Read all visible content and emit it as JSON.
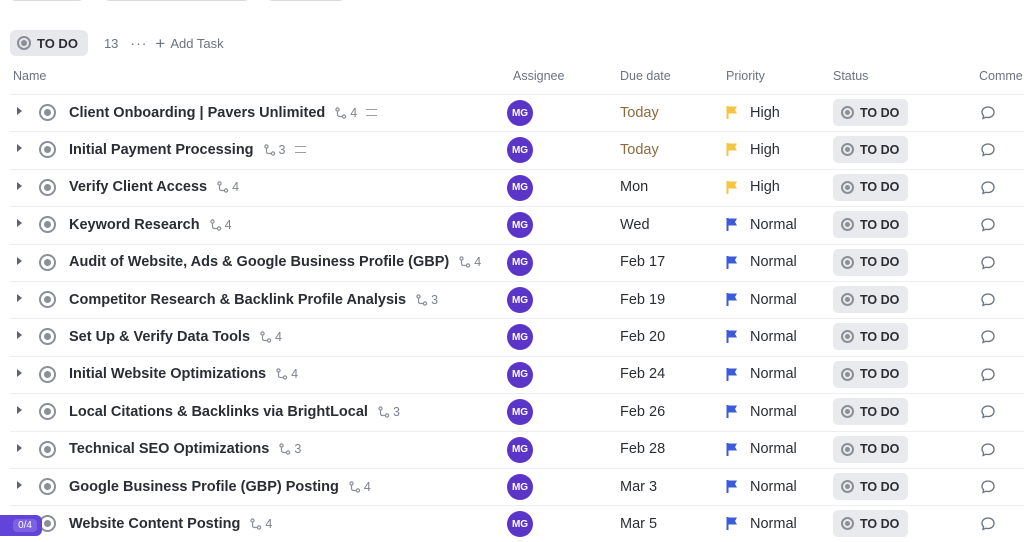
{
  "group": {
    "status_label": "TO DO",
    "count": "13",
    "more_label": "···",
    "add_task_label": "Add Task"
  },
  "columns": {
    "name": "Name",
    "assignee": "Assignee",
    "due_date": "Due date",
    "priority": "Priority",
    "status": "Status",
    "comments": "Comme"
  },
  "tasks": [
    {
      "name": "Client Onboarding | Pavers Unlimited",
      "subtasks": "4",
      "has_description": true,
      "assignee": "MG",
      "due": "Today",
      "due_style": "today",
      "priority": "High",
      "status": "TO DO"
    },
    {
      "name": "Initial Payment Processing",
      "subtasks": "3",
      "has_description": true,
      "assignee": "MG",
      "due": "Today",
      "due_style": "today",
      "priority": "High",
      "status": "TO DO"
    },
    {
      "name": "Verify Client Access",
      "subtasks": "4",
      "has_description": false,
      "assignee": "MG",
      "due": "Mon",
      "due_style": "normal",
      "priority": "High",
      "status": "TO DO"
    },
    {
      "name": "Keyword Research",
      "subtasks": "4",
      "has_description": false,
      "assignee": "MG",
      "due": "Wed",
      "due_style": "normal",
      "priority": "Normal",
      "status": "TO DO"
    },
    {
      "name": "Audit of Website, Ads & Google Business Profile (GBP)",
      "subtasks": "4",
      "has_description": false,
      "assignee": "MG",
      "due": "Feb 17",
      "due_style": "normal",
      "priority": "Normal",
      "status": "TO DO"
    },
    {
      "name": "Competitor Research & Backlink Profile Analysis",
      "subtasks": "3",
      "has_description": false,
      "assignee": "MG",
      "due": "Feb 19",
      "due_style": "normal",
      "priority": "Normal",
      "status": "TO DO"
    },
    {
      "name": "Set Up & Verify Data Tools",
      "subtasks": "4",
      "has_description": false,
      "assignee": "MG",
      "due": "Feb 20",
      "due_style": "normal",
      "priority": "Normal",
      "status": "TO DO"
    },
    {
      "name": "Initial Website Optimizations",
      "subtasks": "4",
      "has_description": false,
      "assignee": "MG",
      "due": "Feb 24",
      "due_style": "normal",
      "priority": "Normal",
      "status": "TO DO"
    },
    {
      "name": "Local Citations & Backlinks via BrightLocal",
      "subtasks": "3",
      "has_description": false,
      "assignee": "MG",
      "due": "Feb 26",
      "due_style": "normal",
      "priority": "Normal",
      "status": "TO DO"
    },
    {
      "name": "Technical SEO Optimizations",
      "subtasks": "3",
      "has_description": false,
      "assignee": "MG",
      "due": "Feb 28",
      "due_style": "normal",
      "priority": "Normal",
      "status": "TO DO"
    },
    {
      "name": "Google Business Profile (GBP) Posting",
      "subtasks": "4",
      "has_description": false,
      "assignee": "MG",
      "due": "Mar 3",
      "due_style": "normal",
      "priority": "Normal",
      "status": "TO DO"
    },
    {
      "name": "Website Content Posting",
      "subtasks": "4",
      "has_description": false,
      "assignee": "MG",
      "due": "Mar 5",
      "due_style": "normal",
      "priority": "Normal",
      "status": "TO DO"
    }
  ],
  "counter_badge": "0/4",
  "colors": {
    "high_flag": "#f5c542",
    "normal_flag": "#3b5bdb",
    "avatar": "#5b35c7",
    "today_text": "#8a6b3c",
    "badge": "#6244d8"
  }
}
